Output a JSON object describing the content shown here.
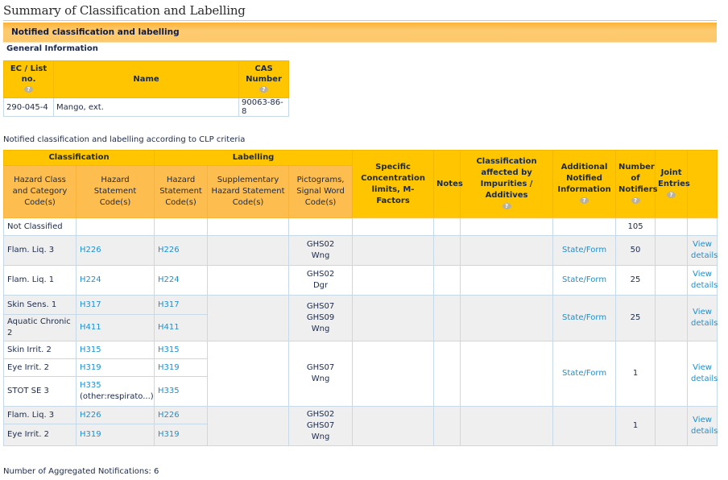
{
  "page_title": "Summary of Classification and Labelling",
  "section_title": "Notified classification and labelling",
  "general_information": {
    "heading": "General Information",
    "columns": [
      "EC / List no.",
      "Name",
      "CAS Number"
    ],
    "row": {
      "ec": "290-045-4",
      "name": "Mango, ext.",
      "cas": "90063-86-8"
    }
  },
  "clp": {
    "caption": "Notified classification and labelling according to CLP criteria",
    "group_headers": {
      "classification": "Classification",
      "labelling": "Labelling"
    },
    "headers": {
      "hazard_class": "Hazard Class and Category Code(s)",
      "hazard_statement_class": "Hazard Statement Code(s)",
      "hazard_statement_label": "Hazard Statement Code(s)",
      "supplementary": "Supplementary Hazard Statement Code(s)",
      "pictograms": "Pictograms, Signal Word Code(s)",
      "scl": "Specific Concentration limits, M-Factors",
      "notes": "Notes",
      "impurities": "Classification affected by Impurities / Additives",
      "additional": "Additional Notified Information",
      "notifiers": "Number of Notifiers",
      "joint": "Joint Entries"
    },
    "help_icon": "help-icon",
    "rows": {
      "r0": {
        "hazard_class": "Not Classified",
        "notifiers": "105"
      },
      "r1": {
        "hazard_class": "Flam. Liq. 3",
        "h_class": "H226",
        "h_label": "H226",
        "pict1": "GHS02",
        "signal": "Wng",
        "additional": "State/Form",
        "notifiers": "50",
        "view1": "View",
        "view2": "details"
      },
      "r2": {
        "hazard_class": "Flam. Liq. 1",
        "h_class": "H224",
        "h_label": "H224",
        "pict1": "GHS02",
        "signal": "Dgr",
        "additional": "State/Form",
        "notifiers": "25",
        "view1": "View",
        "view2": "details"
      },
      "r3": {
        "a_class": "Skin Sens. 1",
        "a_h_class": "H317",
        "a_h_label": "H317",
        "b_class": "Aquatic Chronic 2",
        "b_h_class": "H411",
        "b_h_label": "H411",
        "pict1": "GHS07",
        "pict2": "GHS09",
        "signal": "Wng",
        "additional": "State/Form",
        "notifiers": "25",
        "view1": "View",
        "view2": "details"
      },
      "r4": {
        "a_class": "Skin Irrit. 2",
        "a_h_class": "H315",
        "a_h_label": "H315",
        "b_class": "Eye Irrit. 2",
        "b_h_class": "H319",
        "b_h_label": "H319",
        "c_class": "STOT SE 3",
        "c_h_class": "H335",
        "c_h_class_note": "(other:respirato...)",
        "c_h_label": "H335",
        "pict1": "GHS07",
        "signal": "Wng",
        "additional": "State/Form",
        "notifiers": "1",
        "view1": "View",
        "view2": "details"
      },
      "r5": {
        "a_class": "Flam. Liq. 3",
        "a_h_class": "H226",
        "a_h_label": "H226",
        "b_class": "Eye Irrit. 2",
        "b_h_class": "H319",
        "b_h_label": "H319",
        "pict1": "GHS02",
        "pict2": "GHS07",
        "signal": "Wng",
        "notifiers": "1",
        "view1": "View",
        "view2": "details"
      }
    }
  },
  "footer": "Number of Aggregated Notifications: 6"
}
